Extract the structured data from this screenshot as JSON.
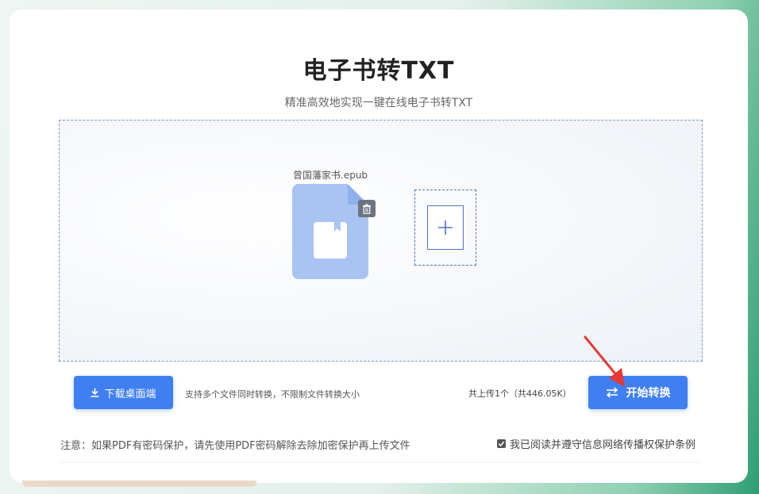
{
  "header": {
    "title": "电子书转TXT",
    "subtitle": "精准高效地实现一键在线电子书转TXT"
  },
  "upload": {
    "file_name": "曾国藩家书.epub",
    "delete_icon": "trash-icon",
    "add_icon": "plus-icon"
  },
  "toolbar": {
    "download_label": "下载桌面端",
    "support_text": "支持多个文件同时转换，不限制文件转换大小",
    "count_text": "共上传1个（共446.05K）",
    "convert_label": "开始转换"
  },
  "footer": {
    "note": "注意：如果PDF有密码保护，请先使用PDF密码解除去除加密保护再上传文件",
    "agree_label": "我已阅读并遵守信息网络传播权保护条例"
  },
  "colors": {
    "accent": "#3f7ff2",
    "file_icon": "#a9c4f3",
    "annotation_arrow": "#e53935"
  }
}
